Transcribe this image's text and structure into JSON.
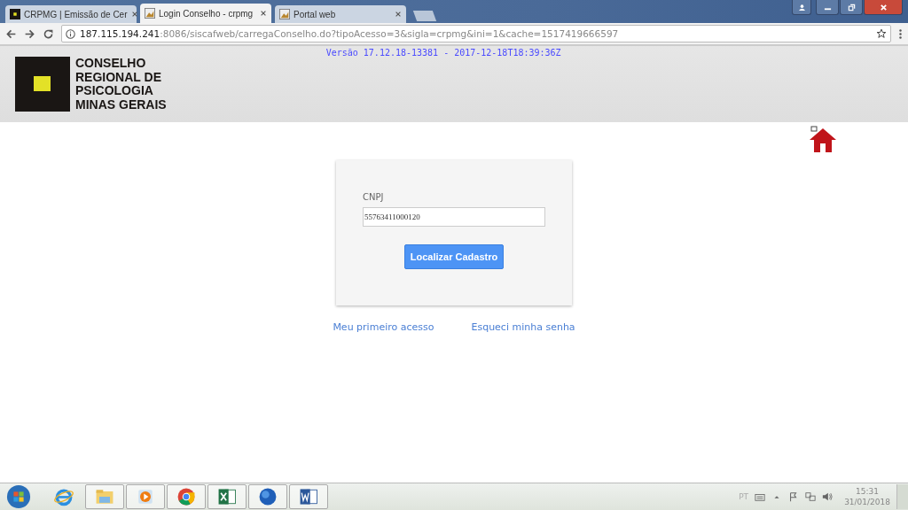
{
  "browser": {
    "tabs": [
      {
        "title": "CRPMG | Emissão de Cer",
        "selected": false,
        "kind": "logo"
      },
      {
        "title": "Login Conselho - crpmg",
        "selected": true,
        "kind": "image"
      },
      {
        "title": "Portal web",
        "selected": false,
        "kind": "image"
      }
    ],
    "address": {
      "host": "187.115.194.241",
      "rest": ":8086/siscafweb/carregaConselho.do?tipoAcesso=3&sigla=crpmg&ini=1&cache=1517419666597"
    }
  },
  "header": {
    "logo_lines": [
      "CONSELHO",
      "REGIONAL DE",
      "PSICOLOGIA",
      "MINAS GERAIS"
    ],
    "version": "Versão 17.12.18-13381 - 2017-12-18T18:39:36Z"
  },
  "form": {
    "label": "CNPJ",
    "value": "55763411000120",
    "button": "Localizar Cadastro"
  },
  "links": [
    "Meu primeiro acesso",
    "Esqueci minha senha"
  ],
  "taskbar": {
    "apps": [
      {
        "kind": "ie"
      },
      {
        "kind": "explorer"
      },
      {
        "kind": "media"
      },
      {
        "kind": "chrome"
      },
      {
        "kind": "excel"
      },
      {
        "kind": "globe"
      },
      {
        "kind": "word"
      }
    ],
    "language": "PT",
    "time": "15:31",
    "date": "31/01/2018"
  }
}
